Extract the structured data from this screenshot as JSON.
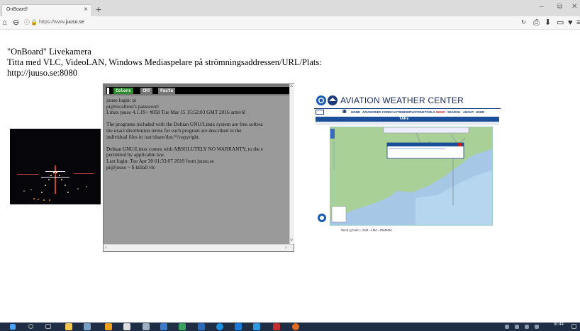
{
  "browser": {
    "tab_title": "OnBoard!",
    "tab_close": "×",
    "new_tab": "+",
    "url_prefix": "https://www.",
    "url_host": "juuso.se",
    "window_controls": {
      "minimize": "–",
      "maximize": "⧉",
      "close": "✕"
    }
  },
  "page": {
    "line1": "\"OnBoard\" Livekamera",
    "line2": "Titta med VLC, VideoLAN, Windows Mediaspelare på strömningsaddressen/URL/Plats:",
    "line3": "http://juuso.se:8080"
  },
  "terminal": {
    "buttons": [
      "Colors",
      "CRT",
      "Paste"
    ],
    "lines": [
      "juuso login: pi",
      "pi@localhost's password:",
      "Linux juuso 4.1.19+ #858 Tue Mar 15 15:52:03 GMT 2016 armv6l",
      "",
      "The programs included with the Debian GNU/Linux system are free softwa",
      "the exact distribution terms for each program are described in the",
      "individual files in /usr/share/doc/*/copyright.",
      "",
      "Debian GNU/Linux comes with ABSOLUTELY NO WARRANTY, to the e",
      "permitted by applicable law.",
      "Last login: Tue Apr 30 01:33:07 2019 from juuso.se",
      "pi@juuso ~ $ killall vlc"
    ]
  },
  "weather": {
    "title": "AVIATION WEATHER CENTER",
    "nav": [
      "HOME",
      "ADVISORIES",
      "FORECASTS",
      "OBSERVATIONS",
      "TOOLS",
      "NEWS",
      "SEARCH",
      "ABOUT",
      "USER"
    ],
    "band_title": "TAFs",
    "legend": "Wind   ◎Calm ⌐15kt ⌐10kt ⌐25kt50kt"
  },
  "taskbar": {
    "clock": "01:44"
  },
  "colors": {
    "tab_strip": "#dcdcdc",
    "taskbar": "#1f2d45",
    "terminal_bg": "#9a9a9a",
    "aw_band": "#1c4f9a"
  }
}
